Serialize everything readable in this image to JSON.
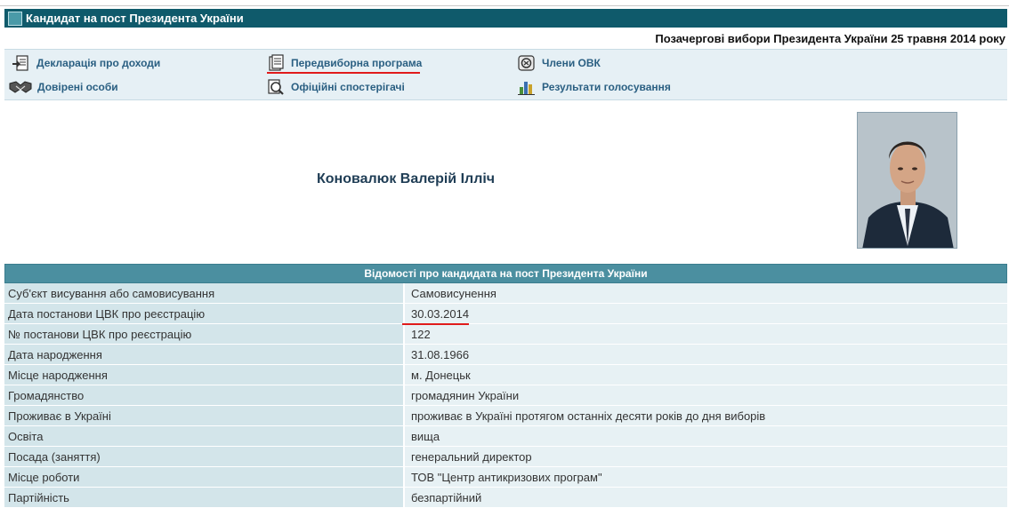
{
  "header": {
    "title": "Кандидат на пост Президента України",
    "election": "Позачергові вибори Президента України 25 травня 2014 року"
  },
  "nav": {
    "items": [
      {
        "label": "Декларація про доходи",
        "icon": "declaration-icon"
      },
      {
        "label": "Передвиборна програма",
        "icon": "program-document-icon"
      },
      {
        "label": "Члени ОВК",
        "icon": "commission-members-icon"
      },
      {
        "label": "Довірені особи",
        "icon": "handshake-icon"
      },
      {
        "label": "Офіційні спостерігачі",
        "icon": "magnifier-icon"
      },
      {
        "label": "Результати голосування",
        "icon": "results-bar-icon"
      }
    ]
  },
  "candidate": {
    "name": "Коновалюк Валерій Ілліч"
  },
  "table": {
    "header": "Відомості про кандидата на пост Президента України",
    "rows": [
      {
        "key": "Суб'єкт висування або самовисування",
        "value": "Самовисунення"
      },
      {
        "key": "Дата постанови ЦВК про реєстрацію",
        "value": "30.03.2014"
      },
      {
        "key": "№ постанови ЦВК про реєстрацію",
        "value": "122"
      },
      {
        "key": "Дата народження",
        "value": "31.08.1966"
      },
      {
        "key": "Місце народження",
        "value": "м. Донецьк"
      },
      {
        "key": "Громадянство",
        "value": "громадянин України"
      },
      {
        "key": "Проживає в Україні",
        "value": "проживає в Україні протягом останніх десяти років до дня виборів"
      },
      {
        "key": "Освіта",
        "value": "вища"
      },
      {
        "key": "Посада (заняття)",
        "value": "генеральний директор"
      },
      {
        "key": "Місце роботи",
        "value": "ТОВ \"Центр антикризових програм\""
      },
      {
        "key": "Партійність",
        "value": "безпартійний"
      }
    ]
  },
  "colors": {
    "title_bar": "#0f5a6b",
    "table_header": "#4b8fa0",
    "link": "#2a5f82",
    "annotation_red": "#e01b1b"
  }
}
